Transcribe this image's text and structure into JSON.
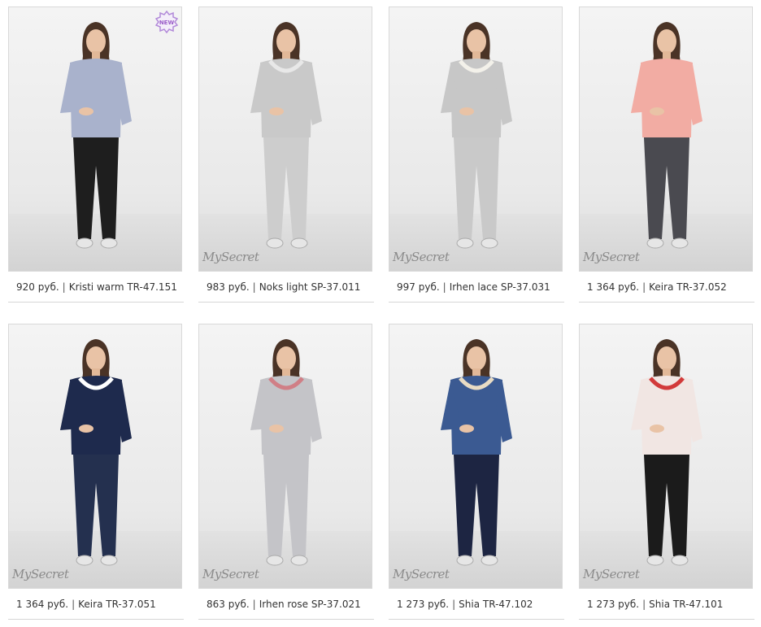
{
  "products": [
    {
      "price": "920 руб.",
      "name": "Kristi warm TR-47.151",
      "badge": "NEW",
      "logo": "",
      "top_color": "#a9b2cc",
      "bottom_color": "#1e1e1e",
      "accent_color": "#a9b2cc"
    },
    {
      "price": "983 руб.",
      "name": "Noks light SP-37.011",
      "badge": "",
      "logo": "MySecret",
      "top_color": "#c9c9c9",
      "bottom_color": "#cdcdcd",
      "accent_color": "#e8e8e8"
    },
    {
      "price": "997 руб.",
      "name": "Irhen lace SP-37.031",
      "badge": "",
      "logo": "MySecret",
      "top_color": "#c7c7c7",
      "bottom_color": "#c9c9c9",
      "accent_color": "#f3f1ea"
    },
    {
      "price": "1 364 руб.",
      "name": "Keira TR-37.052",
      "badge": "",
      "logo": "MySecret",
      "top_color": "#f2aca3",
      "bottom_color": "#4a4a50",
      "accent_color": "#f2aca3"
    },
    {
      "price": "1 364 руб.",
      "name": "Keira TR-37.051",
      "badge": "",
      "logo": "MySecret",
      "top_color": "#1e2a4d",
      "bottom_color": "#24304f",
      "accent_color": "#ffffff"
    },
    {
      "price": "863 руб.",
      "name": "Irhen rose SP-37.021",
      "badge": "",
      "logo": "MySecret",
      "top_color": "#c4c4c8",
      "bottom_color": "#c4c4c8",
      "accent_color": "#d07f86"
    },
    {
      "price": "1 273 руб.",
      "name": "Shia TR-47.102",
      "badge": "",
      "logo": "MySecret",
      "top_color": "#3b5a92",
      "bottom_color": "#1d2542",
      "accent_color": "#e9dcc4"
    },
    {
      "price": "1 273 руб.",
      "name": "Shia TR-47.101",
      "badge": "",
      "logo": "MySecret",
      "top_color": "#f1e6e3",
      "bottom_color": "#1b1b1b",
      "accent_color": "#d23a3a"
    }
  ],
  "separator": "|"
}
